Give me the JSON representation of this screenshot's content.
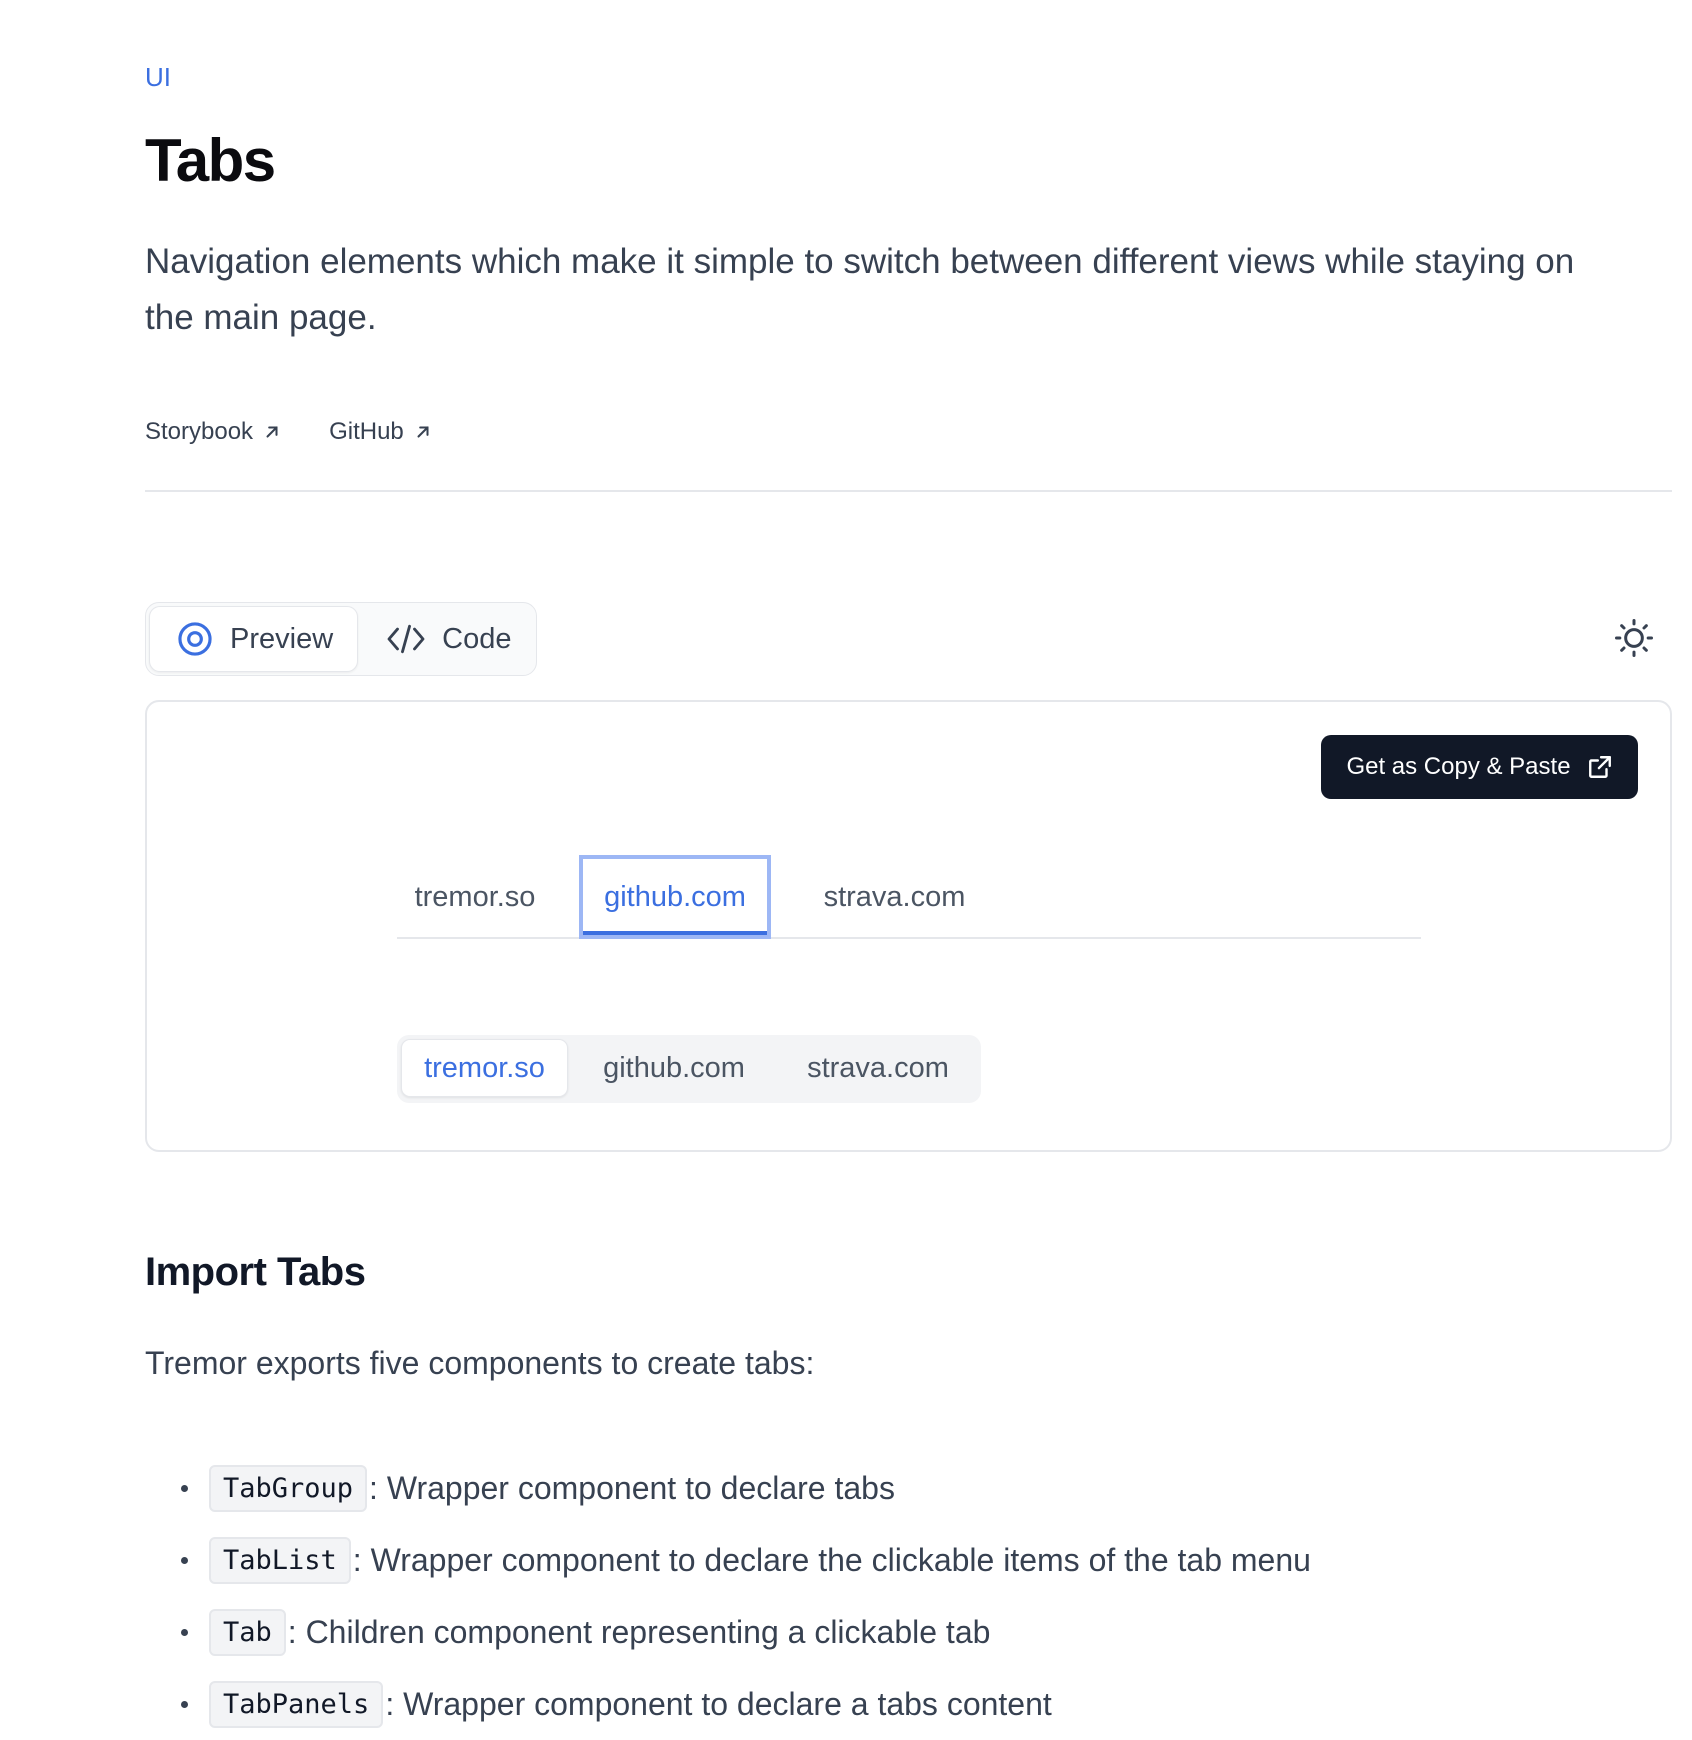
{
  "header": {
    "eyebrow": "UI",
    "title": "Tabs",
    "description": "Navigation elements which make it simple to switch between different views while staying on the main page."
  },
  "links": [
    {
      "label": "Storybook",
      "icon": "arrow-up-right-icon"
    },
    {
      "label": "GitHub",
      "icon": "arrow-up-right-icon"
    }
  ],
  "view_toggle": {
    "preview_label": "Preview",
    "code_label": "Code",
    "active": "Preview"
  },
  "theme_toggle_icon": "sun-icon",
  "preview": {
    "copy_button_label": "Get as Copy & Paste",
    "line_tabs": [
      "tremor.so",
      "github.com",
      "strava.com"
    ],
    "line_tabs_selected": "github.com",
    "solid_tabs": [
      "tremor.so",
      "github.com",
      "strava.com"
    ],
    "solid_tabs_selected": "tremor.so"
  },
  "import_section": {
    "heading": "Import Tabs",
    "intro": "Tremor exports five components to create tabs:",
    "items": [
      {
        "code": "TabGroup",
        "text": ": Wrapper component to declare tabs"
      },
      {
        "code": "TabList",
        "text": ": Wrapper component to declare the clickable items of the tab menu"
      },
      {
        "code": "Tab",
        "text": ": Children component representing a clickable tab"
      },
      {
        "code": "TabPanels",
        "text": ": Wrapper component to declare a tabs content"
      }
    ]
  },
  "colors": {
    "accent": "#3b6fe0",
    "button_dark": "#111827",
    "border": "#e5e7eb",
    "text": "#374151"
  }
}
